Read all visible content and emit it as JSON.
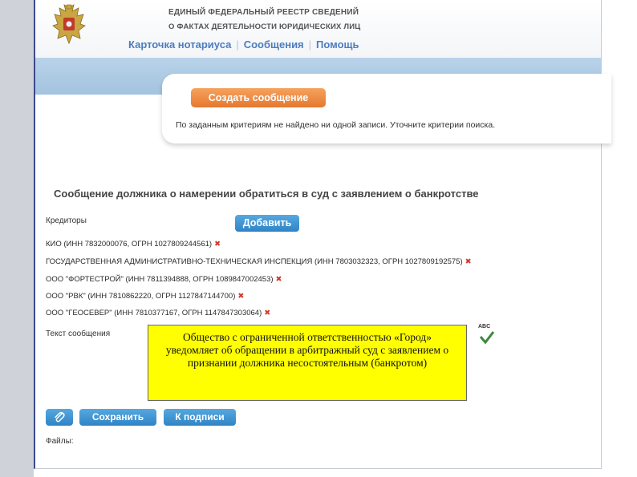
{
  "header": {
    "title_line1": "ЕДИНЫЙ ФЕДЕРАЛЬНЫЙ РЕЕСТР СВЕДЕНИЙ",
    "title_line2": "О ФАКТАХ ДЕЯТЕЛЬНОСТИ ЮРИДИЧЕСКИХ ЛИЦ",
    "nav": [
      {
        "label": "Карточка нотариуса"
      },
      {
        "label": "Сообщения"
      },
      {
        "label": "Помощь"
      }
    ]
  },
  "messages_panel": {
    "create_button": "Создать сообщение",
    "not_found_text": "По заданным критериям не найдено ни одной записи. Уточните критерии поиска."
  },
  "form": {
    "title": "Сообщение должника о намерении обратиться в суд с заявлением о банкротстве",
    "creditors_label": "Кредиторы",
    "add_button": "Добавить",
    "creditors": [
      {
        "text": "КИО (ИНН 7832000076, ОГРН 1027809244561)"
      },
      {
        "text": "ГОСУДАРСТВЕННАЯ АДМИНИСТРАТИВНО-ТЕХНИЧЕСКАЯ ИНСПЕКЦИЯ (ИНН 7803032323, ОГРН 1027809192575)"
      },
      {
        "text": "ООО \"ФОРТЕСТРОЙ\" (ИНН 7811394888, ОГРН 1089847002453)"
      },
      {
        "text": "ООО \"РВК\" (ИНН 7810862220, ОГРН 1127847144700)"
      },
      {
        "text": "ООО \"ГЕОСЕВЕР\" (ИНН 7810377167, ОГРН 1147847303064)"
      }
    ],
    "delete_glyph": "✖",
    "message_label": "Текст сообщения",
    "message_text": "Общество с ограниченной ответственностью «Город» уведомляет об обращении в арбитражный суд с заявлением о признании должника несостоятельным (банкротом)",
    "spellcheck_label": "ABC",
    "save_button": "Сохранить",
    "sign_button": "К подписи",
    "files_label": "Файлы:"
  },
  "colors": {
    "accent_orange": "#e6782e",
    "button_blue": "#2f84c6",
    "nav_blue": "#4c7cbf",
    "highlight_yellow": "#ffff00",
    "delete_red": "#d23a2a"
  },
  "icons": [
    "coat-of-arms-emblem",
    "paperclip-icon",
    "spellcheck-icon",
    "delete-icon"
  ]
}
